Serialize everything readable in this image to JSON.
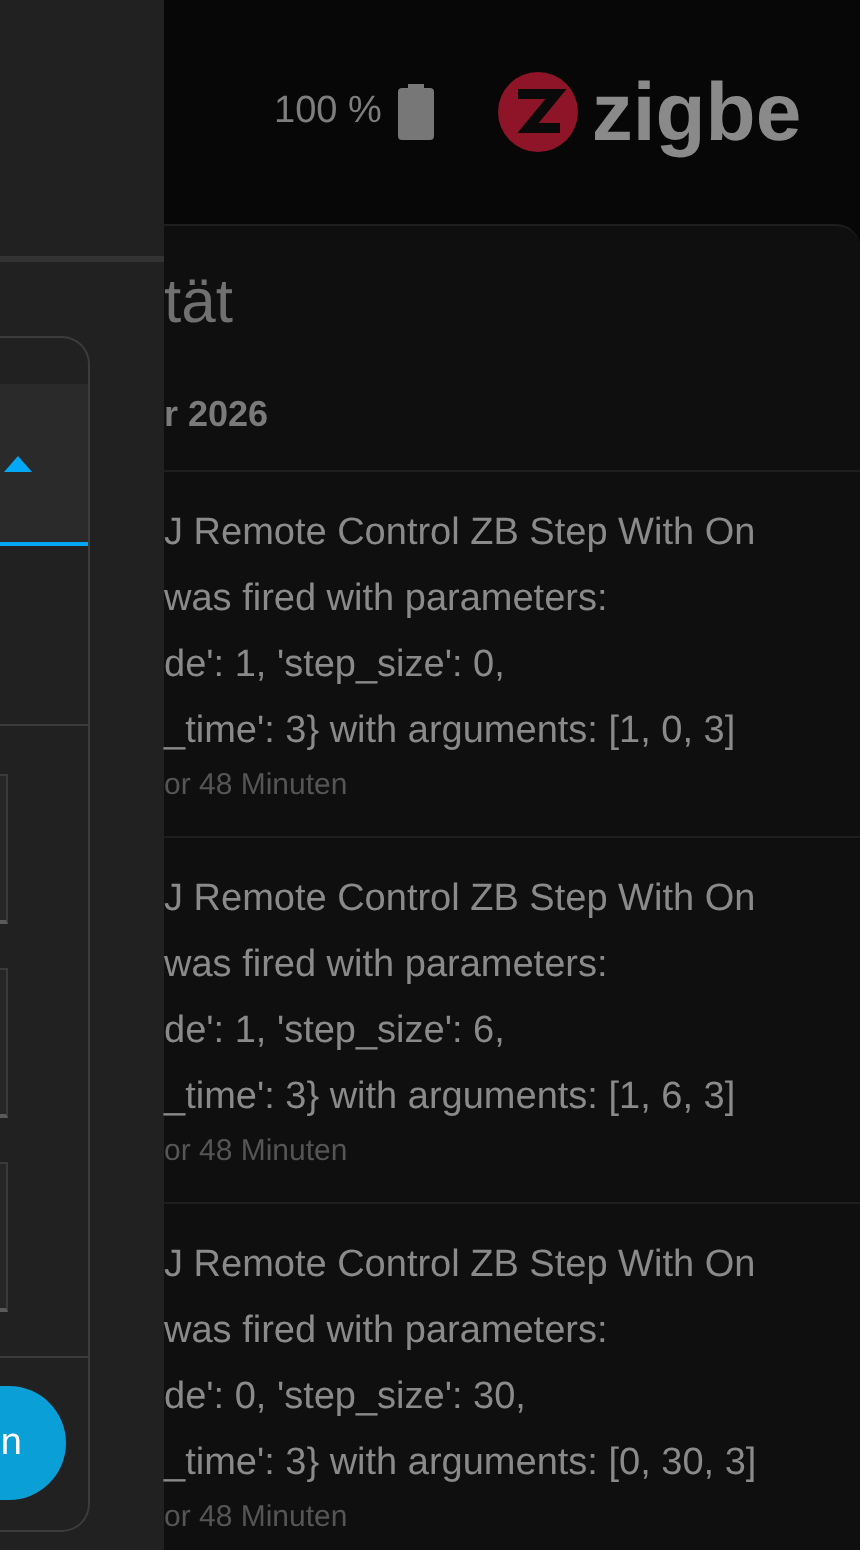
{
  "side_panel": {
    "select": {
      "expanded": true
    },
    "button": {
      "label": "n"
    }
  },
  "header": {
    "battery": "100 %",
    "logo": "zigbe"
  },
  "card": {
    "title": "tät",
    "date": "r 2026",
    "entries": [
      {
        "lines": [
          "J Remote Control ZB Step With On",
          "was fired with parameters:",
          "de': 1, 'step_size': 0,",
          "_time': 3} with arguments: [1, 0, 3]"
        ],
        "time": "or 48 Minuten"
      },
      {
        "lines": [
          "J Remote Control ZB Step With On",
          "was fired with parameters:",
          "de': 1, 'step_size': 6,",
          "_time': 3} with arguments: [1, 6, 3]"
        ],
        "time": "or 48 Minuten"
      },
      {
        "lines": [
          "J Remote Control ZB Step With On",
          "was fired with parameters:",
          "de': 0, 'step_size': 30,",
          "_time': 3} with arguments: [0, 30, 3]"
        ],
        "time": "or 48 Minuten"
      }
    ]
  }
}
